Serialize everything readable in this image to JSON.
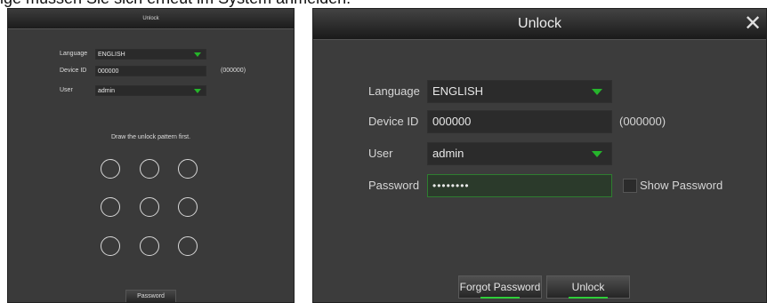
{
  "caption": "ige müssen Sie sich erneut im System anmelden.",
  "small_panel": {
    "title": "Unlock",
    "language_label": "Language",
    "language_value": "ENGLISH",
    "device_id_label": "Device ID",
    "device_id_value": "000000",
    "device_id_hint": "(000000)",
    "user_label": "User",
    "user_value": "admin",
    "pattern_message": "Draw the unlock pattern first.",
    "password_button": "Password"
  },
  "dialog": {
    "title": "Unlock",
    "close_icon": "close-icon",
    "language_label": "Language",
    "language_value": "ENGLISH",
    "device_id_label": "Device ID",
    "device_id_value": "000000",
    "device_id_hint": "(000000)",
    "user_label": "User",
    "user_value": "admin",
    "password_label": "Password",
    "password_value": "••••••••",
    "show_password_label": "Show Password",
    "forgot_button": "Forgot Password",
    "unlock_button": "Unlock"
  },
  "colors": {
    "accent": "#26b52c",
    "panel": "#3c3c3c",
    "field": "#2b2b2b"
  }
}
